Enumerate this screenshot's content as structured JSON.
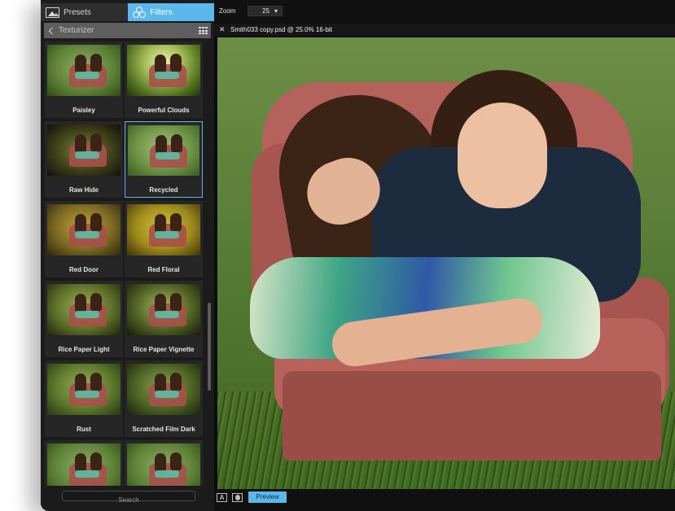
{
  "tabs": [
    {
      "label": "Presets",
      "icon": "image-icon",
      "active": false
    },
    {
      "label": "Filters",
      "icon": "filters-circles-icon",
      "active": true
    }
  ],
  "accent_color": "#5ab8ea",
  "subheader": {
    "title": "Texturizer"
  },
  "filters": [
    {
      "label": "Paisley",
      "tone": "natural"
    },
    {
      "label": "Powerful Clouds",
      "tone": "cloudy-green"
    },
    {
      "label": "Raw Hide",
      "tone": "dark-vignette"
    },
    {
      "label": "Recycled",
      "tone": "green-paper",
      "selected": true
    },
    {
      "label": "Red Door",
      "tone": "warm-yellow"
    },
    {
      "label": "Red Floral",
      "tone": "gold"
    },
    {
      "label": "Rice Paper Light",
      "tone": "green-vignette"
    },
    {
      "label": "Rice Paper Vignette",
      "tone": "dark-green-vignette"
    },
    {
      "label": "Rust",
      "tone": "rust-green"
    },
    {
      "label": "Scratched Film Dark",
      "tone": "dark-film"
    },
    {
      "label": "",
      "tone": "natural"
    },
    {
      "label": "",
      "tone": "natural"
    }
  ],
  "search": {
    "placeholder": "Search"
  },
  "toolbar": {
    "zoom_label": "Zoom",
    "zoom_value": "25"
  },
  "document": {
    "title": "Smith033 copy.psd @ 25.0% 16-bit"
  },
  "statusbar": {
    "a_button": "A",
    "preview_label": "Preview"
  }
}
